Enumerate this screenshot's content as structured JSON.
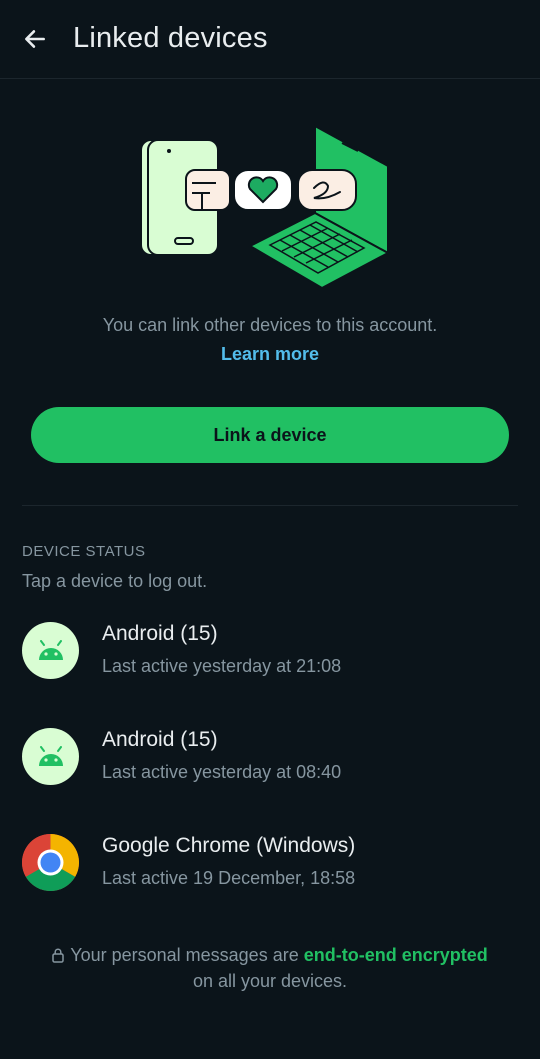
{
  "header": {
    "title": "Linked devices",
    "back_icon": "arrow-left-icon"
  },
  "intro": {
    "text": "You can link other devices to this account.",
    "learn_more": "Learn more"
  },
  "link_button": {
    "label": "Link a device"
  },
  "device_status": {
    "heading": "DEVICE STATUS",
    "subheading": "Tap a device to log out.",
    "devices": [
      {
        "name": "Android (15)",
        "status": "Last active yesterday at 21:08",
        "icon": "android-icon"
      },
      {
        "name": "Android (15)",
        "status": "Last active yesterday at 08:40",
        "icon": "android-icon"
      },
      {
        "name": "Google Chrome (Windows)",
        "status": "Last active 19 December, 18:58",
        "icon": "chrome-icon"
      }
    ]
  },
  "footer": {
    "prefix": "Your personal messages are",
    "highlight": "end-to-end encrypted",
    "suffix": "on all your devices."
  },
  "colors": {
    "background": "#0b141a",
    "accent": "#21c063",
    "link": "#53bdeb",
    "secondary_text": "#8696a0"
  }
}
